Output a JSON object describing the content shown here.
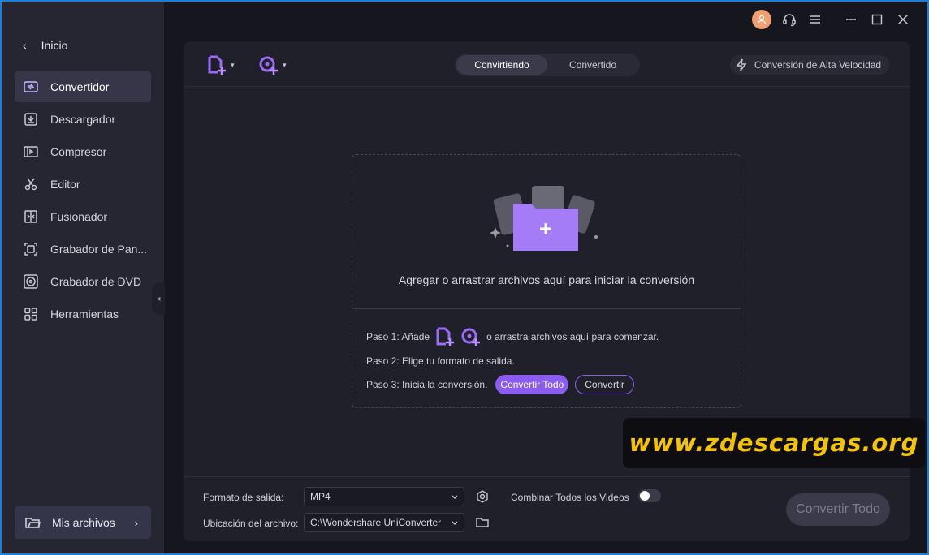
{
  "sidebar": {
    "back_label": "Inicio",
    "items": [
      {
        "label": "Convertidor",
        "icon": "converter-icon",
        "active": true
      },
      {
        "label": "Descargador",
        "icon": "download-icon",
        "active": false
      },
      {
        "label": "Compresor",
        "icon": "compress-icon",
        "active": false
      },
      {
        "label": "Editor",
        "icon": "scissors-icon",
        "active": false
      },
      {
        "label": "Fusionador",
        "icon": "merge-icon",
        "active": false
      },
      {
        "label": "Grabador de Pan...",
        "icon": "screen-record-icon",
        "active": false
      },
      {
        "label": "Grabador de DVD",
        "icon": "dvd-icon",
        "active": false
      },
      {
        "label": "Herramientas",
        "icon": "tools-grid-icon",
        "active": false
      }
    ],
    "my_files_label": "Mis archivos"
  },
  "toolbar": {
    "tabs": [
      {
        "label": "Convirtiendo",
        "active": true
      },
      {
        "label": "Convertido",
        "active": false
      }
    ],
    "high_speed_label": "Conversión de Alta Velocidad"
  },
  "dropzone": {
    "prompt": "Agregar o arrastrar archivos aquí para iniciar la conversión",
    "step1_prefix": "Paso 1: Añade",
    "step1_suffix": "o arrastra archivos aquí para comenzar.",
    "step2": "Paso 2: Elige tu formato de salida.",
    "step3": "Paso 3: Inicia la conversión.",
    "convert_all_label": "Convertir Todo",
    "convert_label": "Convertir"
  },
  "bottom": {
    "output_format_label": "Formato de salida:",
    "output_format_value": "MP4",
    "merge_label": "Combinar Todos los Videos",
    "merge_enabled": false,
    "location_label": "Ubicación del archivo:",
    "location_value": "C:\\Wondershare UniConverter",
    "convert_all_label": "Convertir Todo"
  },
  "watermark": "www.zdescargas.org",
  "colors": {
    "accent": "#8a5cf0",
    "sidebar_bg": "#262633",
    "panel_bg": "#20202b",
    "window_border": "#1b7fd8",
    "watermark_text": "#f5c400"
  }
}
